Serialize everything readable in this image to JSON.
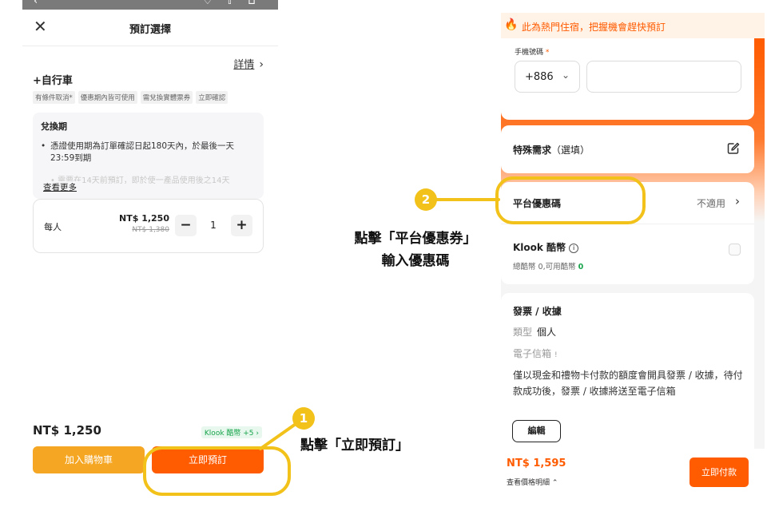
{
  "left": {
    "sheet_title": "預訂選擇",
    "detail_link": "詳情",
    "product_name": "+自行車",
    "tags": [
      "有條件取消*",
      "優惠期內皆可使用",
      "需兌換實體票券",
      "立即確認"
    ],
    "redeem": {
      "title": "兌換期",
      "item": "憑證使用期為訂單確認日起180天內，於最後一天23:59到期",
      "faded_item": "• 需要在14天前預訂，即於使一產品使用後之14天",
      "see_more": "查看更多"
    },
    "quantity": {
      "label": "每人",
      "price": "NT$ 1,250",
      "old_price": "NT$ 1,380",
      "minus": "−",
      "value": "1",
      "plus": "+"
    },
    "total": "NT$ 1,250",
    "klook_coins": "Klook 酷幣 +5",
    "cart_button": "加入購物車",
    "book_button": "立即預訂"
  },
  "annotations": {
    "step1_number": "1",
    "step1_text": "點擊「立即預訂」",
    "step2_number": "2",
    "step2_line1": "點擊「平台優惠券」",
    "step2_line2": "輸入優惠碼",
    "accent_color": "#f2c21b"
  },
  "right": {
    "hot_banner": "此為熱門住宿，把握機會趕快預訂",
    "phone_label": "手機號碼",
    "required_mark": "*",
    "country_code": "+886",
    "phone_value": "",
    "special_request": "特殊需求",
    "special_request_optional": "（選填）",
    "promo_label": "平台優惠碼",
    "promo_value": "不適用",
    "coins_label": "Klook 酷幣",
    "coins_sub": "總酷幣 0,可用酷幣 ",
    "coins_available": "0",
    "invoice_title": "發票 / 收據",
    "invoice_type_label": "類型",
    "invoice_type_value": "個人",
    "invoice_email_label": "電子信箱",
    "invoice_email_mark": "!",
    "invoice_desc": "僅以現金和禮物卡付款的額度會開具發票 / 收據，待付款成功後，發票 / 收據將送至電子信箱",
    "invoice_edit": "編輯",
    "bottom_price": "NT$ 1,595",
    "bottom_detail": "查看價格明細",
    "pay_button": "立即付款",
    "brand_color": "#ff5b00"
  }
}
